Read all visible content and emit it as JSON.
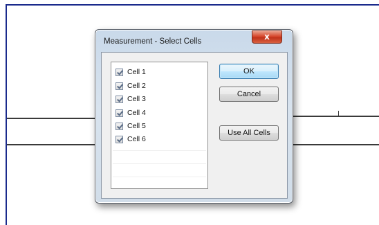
{
  "dialog": {
    "title": "Measurement - Select Cells",
    "close_label": "x"
  },
  "cells": [
    {
      "label": "Cell 1",
      "checked": true
    },
    {
      "label": "Cell 2",
      "checked": true
    },
    {
      "label": "Cell 3",
      "checked": true
    },
    {
      "label": "Cell 4",
      "checked": true
    },
    {
      "label": "Cell 5",
      "checked": true
    },
    {
      "label": "Cell 6",
      "checked": true
    }
  ],
  "buttons": {
    "ok": "OK",
    "cancel": "Cancel",
    "use_all": "Use All Cells"
  },
  "colors": {
    "frame_accent": "#1a2a8c",
    "close_button": "#d6472c",
    "default_button": "#bee6fd"
  }
}
